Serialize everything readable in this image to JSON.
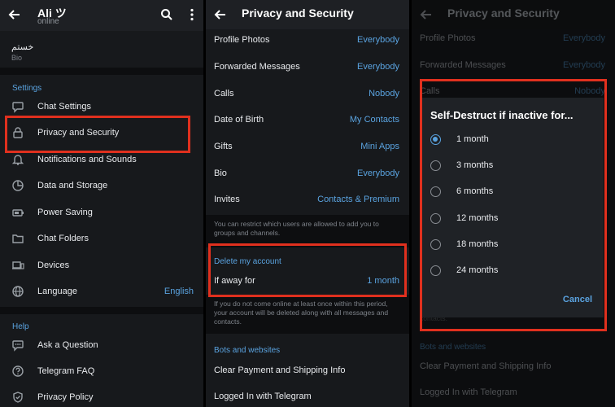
{
  "panel1": {
    "user_name": "Ali ツ",
    "status": "online",
    "bio_text": "خستم",
    "bio_label": "Bio",
    "settings_title": "Settings",
    "items": [
      {
        "label": "Chat Settings",
        "icon": "chat-bubble-icon"
      },
      {
        "label": "Privacy and Security",
        "icon": "lock-icon"
      },
      {
        "label": "Notifications and Sounds",
        "icon": "bell-icon"
      },
      {
        "label": "Data and Storage",
        "icon": "pie-chart-icon"
      },
      {
        "label": "Power Saving",
        "icon": "battery-icon"
      },
      {
        "label": "Chat Folders",
        "icon": "folder-icon"
      },
      {
        "label": "Devices",
        "icon": "devices-icon"
      },
      {
        "label": "Language",
        "icon": "globe-icon",
        "value": "English"
      }
    ],
    "help_title": "Help",
    "help_items": [
      {
        "label": "Ask a Question",
        "icon": "chat-dots-icon"
      },
      {
        "label": "Telegram FAQ",
        "icon": "help-circle-icon"
      },
      {
        "label": "Privacy Policy",
        "icon": "shield-check-icon"
      }
    ]
  },
  "panel2": {
    "title": "Privacy and Security",
    "rows": [
      {
        "label": "Profile Photos",
        "value": "Everybody"
      },
      {
        "label": "Forwarded Messages",
        "value": "Everybody"
      },
      {
        "label": "Calls",
        "value": "Nobody"
      },
      {
        "label": "Date of Birth",
        "value": "My Contacts"
      },
      {
        "label": "Gifts",
        "value": "Mini Apps"
      },
      {
        "label": "Bio",
        "value": "Everybody"
      },
      {
        "label": "Invites",
        "value": "Contacts & Premium"
      }
    ],
    "invites_note": "You can restrict which users are allowed to add you to groups and channels.",
    "delete_title": "Delete my account",
    "away_label": "If away for",
    "away_value": "1 month",
    "delete_note": "If you do not come online at least once within this period, your account will be deleted along with all messages and contacts.",
    "bots_title": "Bots and websites",
    "bots_rows": [
      {
        "label": "Clear Payment and Shipping Info"
      },
      {
        "label": "Logged In with Telegram"
      }
    ]
  },
  "panel3": {
    "title": "Privacy and Security",
    "rows": [
      {
        "label": "Profile Photos",
        "value": "Everybody"
      },
      {
        "label": "Forwarded Messages",
        "value": "Everybody"
      },
      {
        "label": "Calls",
        "value": "Nobody"
      }
    ],
    "dialog_title": "Self-Destruct if inactive for...",
    "options": [
      "1 month",
      "3 months",
      "6 months",
      "12 months",
      "18 months",
      "24 months"
    ],
    "selected_option": "1 month",
    "cancel_label": "Cancel",
    "behind_note": "Your account will be deleted along with all messages and contacts.",
    "bots_title": "Bots and websites",
    "bots_rows": [
      {
        "label": "Clear Payment and Shipping Info"
      },
      {
        "label": "Logged In with Telegram"
      }
    ]
  },
  "colors": {
    "accent": "#5aa3e0",
    "highlight_box": "#e0301e",
    "background": "#17191c"
  }
}
